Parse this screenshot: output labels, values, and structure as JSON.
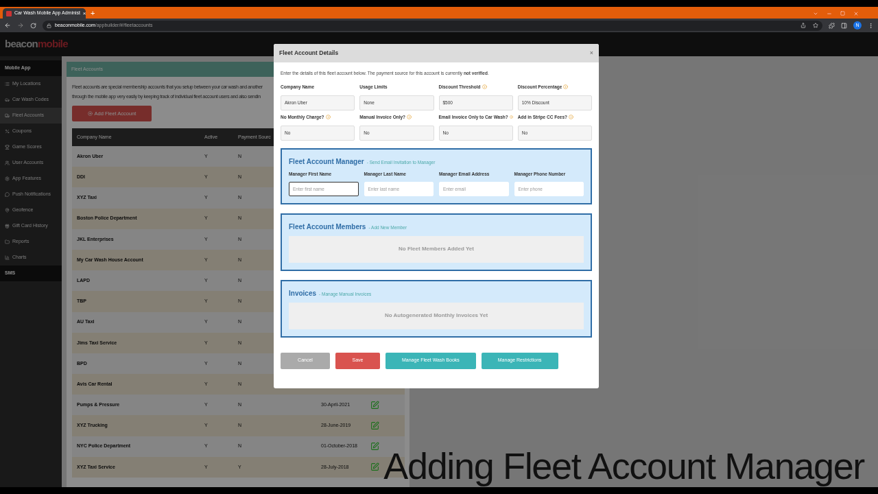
{
  "browser": {
    "tab_title": "Car Wash Mobile App Administ",
    "tab_close": "×",
    "new_tab": "+",
    "url_host": "beaconmobile.com",
    "url_path": "/appbuilder/#/fleetaccounts",
    "avatar": "N"
  },
  "header": {
    "logo_a": "beacon",
    "logo_b": "mobile"
  },
  "sidebar": {
    "items": [
      {
        "kind": "heading",
        "label": "Mobile App",
        "selected": false
      },
      {
        "kind": "item",
        "label": "My Locations",
        "selected": false
      },
      {
        "kind": "item",
        "label": "Car Wash Codes",
        "selected": false
      },
      {
        "kind": "item",
        "label": "Fleet Accounts",
        "selected": true
      },
      {
        "kind": "item",
        "label": "Coupons",
        "selected": false
      },
      {
        "kind": "item",
        "label": "Game Scores",
        "selected": false
      },
      {
        "kind": "item",
        "label": "User Accounts",
        "selected": false
      },
      {
        "kind": "item",
        "label": "App Features",
        "selected": false
      },
      {
        "kind": "item",
        "label": "Push Notifications",
        "selected": false
      },
      {
        "kind": "item",
        "label": "Geofence",
        "selected": false
      },
      {
        "kind": "item",
        "label": "Gift Card History",
        "selected": false
      },
      {
        "kind": "item",
        "label": "Reports",
        "selected": false
      },
      {
        "kind": "item",
        "label": "Charts",
        "selected": false
      },
      {
        "kind": "heading",
        "label": "SMS",
        "selected": false
      }
    ]
  },
  "page": {
    "title": "Fleet Accounts",
    "description": [
      "Fleet accounts are special membership accounts that you setup between your car wash and another",
      "through the mobile app very easily by keeping track of individual fleet account users and also sendin"
    ],
    "add_button": "Add Fleet Account",
    "table": {
      "columns": [
        "Company Name",
        "Active",
        "Payment Sourc"
      ],
      "rows": [
        {
          "company": "Akron Uber",
          "active": "Y",
          "payment": "N"
        },
        {
          "company": "DDI",
          "active": "Y",
          "payment": "N"
        },
        {
          "company": "XYZ Taxi",
          "active": "Y",
          "payment": "N"
        },
        {
          "company": "Boston Police Department",
          "active": "Y",
          "payment": "N"
        },
        {
          "company": "JKL Enterprises",
          "active": "Y",
          "payment": "N"
        },
        {
          "company": "My Car Wash House Account",
          "active": "Y",
          "payment": "N"
        },
        {
          "company": "LAPD",
          "active": "Y",
          "payment": "N"
        },
        {
          "company": "TBP",
          "active": "Y",
          "payment": "N"
        },
        {
          "company": "AU Taxi",
          "active": "Y",
          "payment": "N"
        },
        {
          "company": "Jims Taxi Service",
          "active": "Y",
          "payment": "N"
        },
        {
          "company": "BPD",
          "active": "Y",
          "payment": "N"
        },
        {
          "company": "Avis Car Rental",
          "active": "Y",
          "payment": "N"
        },
        {
          "company": "Pumps & Pressure",
          "active": "Y",
          "payment": "N",
          "date": "30-April-2021"
        },
        {
          "company": "XYZ Trucking",
          "active": "Y",
          "payment": "N",
          "date": "28-June-2019"
        },
        {
          "company": "NYC Police Department",
          "active": "Y",
          "payment": "N",
          "date": "01-October-2018"
        },
        {
          "company": "XYZ Taxi Service",
          "active": "Y",
          "payment": "Y",
          "date": "28-July-2018"
        }
      ]
    }
  },
  "modal": {
    "title": "Fleet Account Details",
    "close": "×",
    "intro": "Enter the details of this fleet account below. The payment source for this account is currently **not verified**.",
    "fields": [
      {
        "label": "Company Name",
        "info": false,
        "value": "Akron Uber"
      },
      {
        "label": "Usage Limits",
        "info": false,
        "value": "None"
      },
      {
        "label": "Discount Threshold",
        "info": true,
        "value": "$500"
      },
      {
        "label": "Discount Percentage",
        "info": true,
        "value": "10% Discount"
      },
      {
        "label": "No Monthly Charge?",
        "info": true,
        "value": "No"
      },
      {
        "label": "Manual Invoice Only?",
        "info": true,
        "value": "No"
      },
      {
        "label": "Email Invoice Only to Car Wash?",
        "info": true,
        "value": "No"
      },
      {
        "label": "Add in Stripe CC Fees?",
        "info": true,
        "value": "No"
      }
    ],
    "manager": {
      "title": "Fleet Account Manager",
      "link": "- Send Email Invitation to Manager",
      "inputs": [
        {
          "label": "Manager First Name",
          "placeholder": "Enter first name",
          "focused": true
        },
        {
          "label": "Manager Last Name",
          "placeholder": "Enter last name",
          "focused": false
        },
        {
          "label": "Manager Email Address",
          "placeholder": "Enter email",
          "focused": false
        },
        {
          "label": "Manager Phone Number",
          "placeholder": "Enter phone",
          "focused": false
        }
      ]
    },
    "members": {
      "title": "Fleet Account Members",
      "link": "- Add New Member",
      "empty": "No Fleet Members Added Yet"
    },
    "invoices": {
      "title": "Invoices",
      "link": "- Manage Manual Invoices",
      "empty": "No Autogenerated Monthly Invoices Yet"
    },
    "buttons": [
      {
        "kind": "cancel",
        "label": "Cancel"
      },
      {
        "kind": "save",
        "label": "Save"
      },
      {
        "kind": "action",
        "label": "Manage Fleet Wash Books"
      },
      {
        "kind": "action",
        "label": "Manage Restrictions"
      }
    ]
  },
  "caption": "Adding Fleet Account Manager"
}
